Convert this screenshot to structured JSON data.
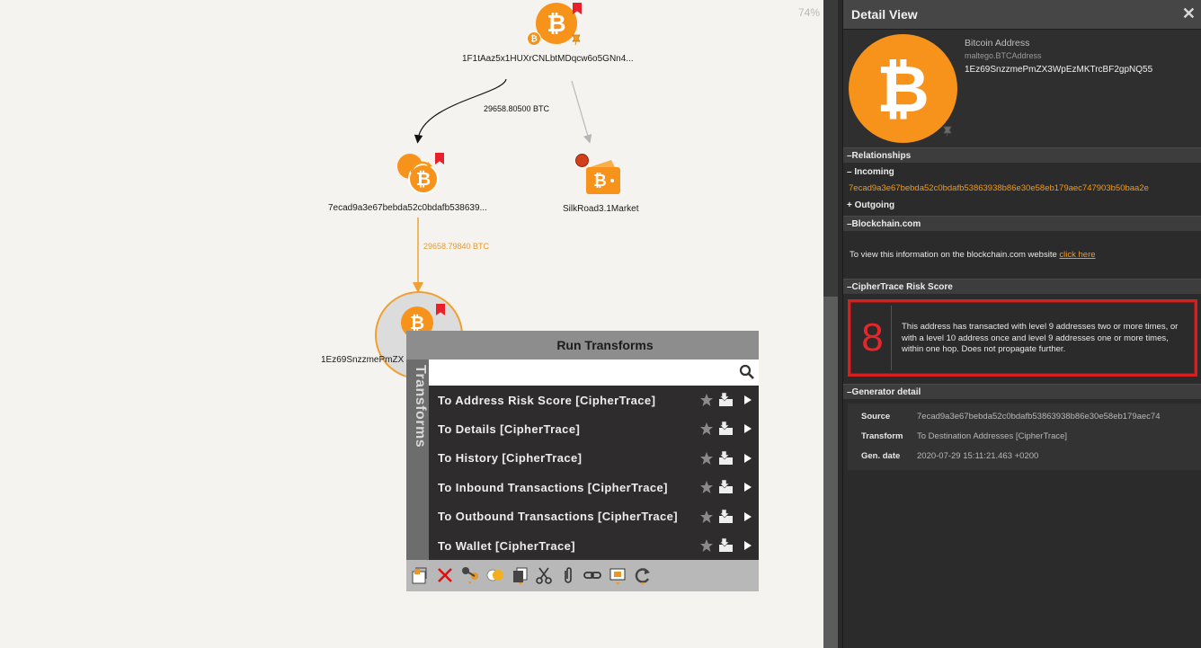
{
  "canvas": {
    "zoom": "74%",
    "nodes": {
      "source_address": "1F1tAaz5x1HUXrCNLbtMDqcw6o5GNn4...",
      "wallet_intermediate": "7ecad9a3e67bebda52c0bdafb538639...",
      "silkroad": "SilkRoad3.1Market",
      "selected_address": "1Ez69SnzzmePmZX"
    },
    "edges": {
      "edge1_label": "29658.80500 BTC",
      "edge2_label": "29658.79840 BTC"
    },
    "colors": {
      "bitcoin_orange": "#f7931a",
      "flag_red": "#e8202a",
      "edge_orange": "#f0a030"
    }
  },
  "run_transforms": {
    "title": "Run Transforms",
    "side_label": "Transforms",
    "search_placeholder": "",
    "items": [
      {
        "label": "To Address Risk Score [CipherTrace]"
      },
      {
        "label": "To Details [CipherTrace]"
      },
      {
        "label": "To History [CipherTrace]"
      },
      {
        "label": "To Inbound Transactions [CipherTrace]"
      },
      {
        "label": "To Outbound Transactions [CipherTrace]"
      },
      {
        "label": "To Wallet [CipherTrace]"
      }
    ],
    "toolbar_icons": [
      "add-entity-icon",
      "delete-icon",
      "link-icon",
      "toggle-icon",
      "copy-icon",
      "cut-icon",
      "attach-icon",
      "chain-icon",
      "select-icon",
      "refresh-icon"
    ]
  },
  "detail_view": {
    "title": "Detail View",
    "close": "✕",
    "entity_type": "Bitcoin Address",
    "entity_class": "maltego.BTCAddress",
    "entity_value": "1Ez69SnzzmePmZX3WpEzMKTrcBF2gpNQ55",
    "sections": {
      "relationships": "–Relationships",
      "incoming": "– Incoming",
      "incoming_value": "7ecad9a3e67bebda52c0bdafb53863938b86e30e58eb179aec747903b50baa2e",
      "outgoing": "+ Outgoing",
      "blockchain": "–Blockchain.com",
      "blockchain_text": "To view this information on the blockchain.com website",
      "blockchain_link": "click here",
      "ciphertrace": "–CipherTrace Risk Score",
      "risk_score": "8",
      "risk_text": "This address has transacted with level 9 addresses two or more times, or with a level 10 address once and level 9 addresses one or more times, within one hop. Does not propagate further.",
      "generator": "–Generator detail",
      "gen_source_key": "Source",
      "gen_source_val": "7ecad9a3e67bebda52c0bdafb53863938b86e30e58eb179aec74",
      "gen_transform_key": "Transform",
      "gen_transform_val": "To Destination Addresses [CipherTrace]",
      "gen_date_key": "Gen. date",
      "gen_date_val": "2020-07-29 15:11:21.463 +0200"
    },
    "colors": {
      "risk_red": "#e8262a",
      "link_orange": "#f29a1c"
    }
  }
}
